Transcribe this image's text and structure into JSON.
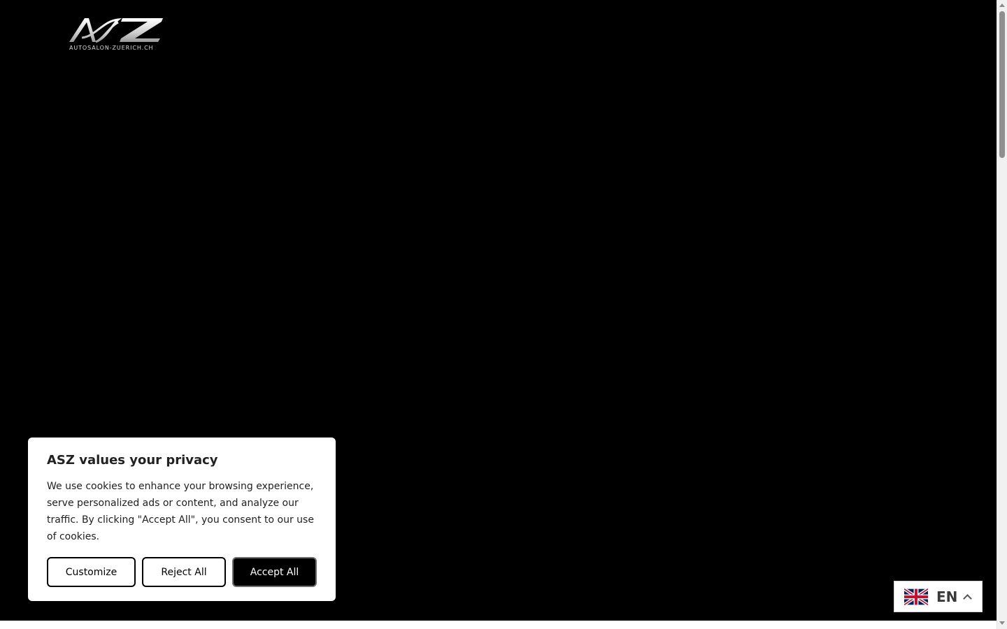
{
  "logo": {
    "mark_text": "ASZ",
    "subtitle": "AUTOSALON-ZUERICH.CH"
  },
  "cookie_banner": {
    "title": "ASZ values your privacy",
    "body": "We use cookies to enhance your browsing experience, serve personalized ads or content, and analyze our traffic. By clicking \"Accept All\", you consent to our use of cookies.",
    "buttons": {
      "customize": "Customize",
      "reject": "Reject All",
      "accept": "Accept All"
    }
  },
  "language_switcher": {
    "selected": "EN",
    "flag_icon": "uk-flag-icon",
    "chevron_icon": "chevron-up-icon"
  },
  "colors": {
    "page_background": "#000000",
    "banner_background": "#ffffff",
    "accept_button": "#000000"
  }
}
